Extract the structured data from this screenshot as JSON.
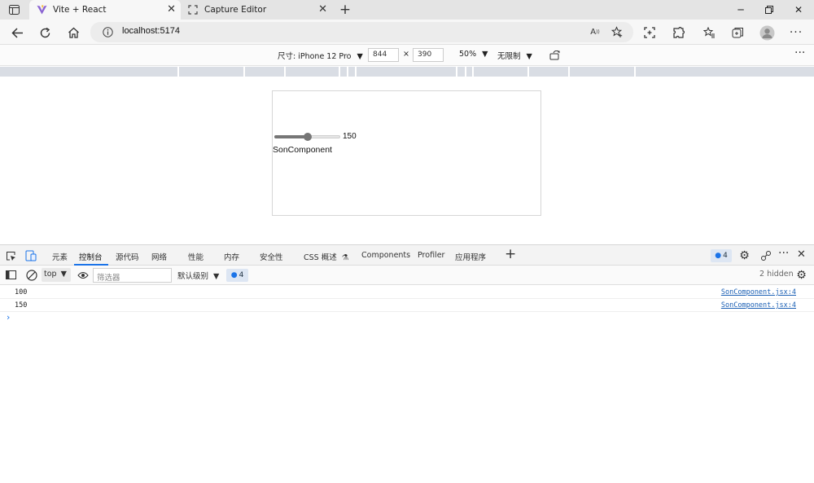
{
  "browser": {
    "tabs": [
      {
        "title": "Vite + React",
        "icon": "vite-icon",
        "active": true
      },
      {
        "title": "Capture Editor",
        "icon": "capture-icon",
        "active": false
      }
    ],
    "new_tab_icon": "plus-icon",
    "window_controls": [
      "minimize-icon",
      "maximize-icon",
      "close-icon"
    ],
    "address": "localhost:5174"
  },
  "device_toolbar": {
    "device": "尺寸: iPhone 12 Pro",
    "width": "844",
    "times": "×",
    "height": "390",
    "zoom": "50%",
    "throttle": "无限制"
  },
  "page": {
    "slider": {
      "value_label": "150",
      "level": 0.5,
      "fill_color": "#767676"
    },
    "component_text": "SonComponent"
  },
  "devtools": {
    "tabs": [
      "元素",
      "控制台",
      "源代码",
      "网络",
      "性能",
      "内存",
      "安全性",
      "CSS 概述",
      "Components",
      "Profiler",
      "应用程序"
    ],
    "active_tab": "控制台",
    "issues_count": "4",
    "accent_color": "#1a73e8"
  },
  "console_bar": {
    "context": "top",
    "filter_placeholder": "筛选器",
    "levels": "默认级别",
    "message_count": "4",
    "hidden": "2 hidden"
  },
  "console": {
    "rows": [
      {
        "message": "100",
        "source": "SonComponent.jsx:4"
      },
      {
        "message": "150",
        "source": "SonComponent.jsx:4"
      }
    ],
    "prompt": "›"
  }
}
